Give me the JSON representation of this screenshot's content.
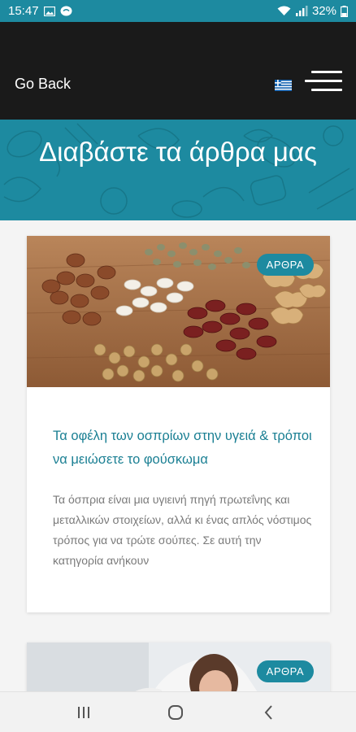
{
  "status_bar": {
    "time": "15:47",
    "battery": "32%"
  },
  "header": {
    "back_label": "Go Back",
    "language_flag": "greek-flag-icon",
    "menu_icon": "hamburger-menu-icon"
  },
  "hero": {
    "title": "Διαβάστε τα άρθρα μας"
  },
  "articles": [
    {
      "badge": "ΑΡΘΡΑ",
      "title": "Τα οφέλη των οσπρίων στην υγειά & τρόποι να μειώσετε το φούσκωμα",
      "excerpt": "Τα όσπρια είναι μια υγιεινή πηγή πρωτεΐνης και μεταλλικών στοιχείων, αλλά κι ένας απλός νόστιμος τρόπος για να τρώτε σούπες. Σε αυτή την κατηγορία ανήκουν"
    },
    {
      "badge": "ΑΡΘΡΑ"
    }
  ],
  "colors": {
    "accent": "#1d8aa0",
    "header_bg": "#1a1a1a",
    "title_text": "#1a7f93"
  }
}
